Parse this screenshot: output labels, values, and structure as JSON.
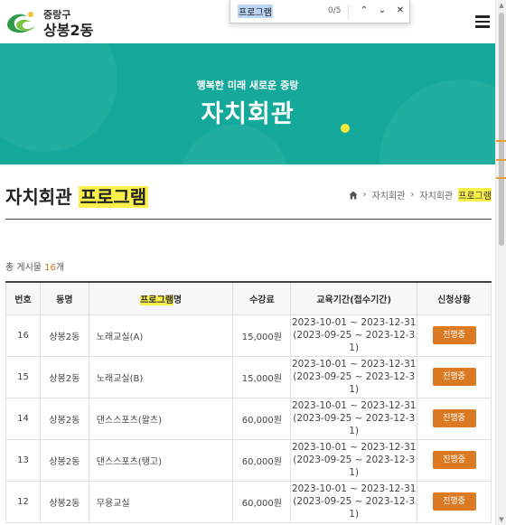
{
  "header": {
    "district": "중랑구",
    "dong": "상봉2동",
    "logo_icon": "jungnang-logo"
  },
  "findbar": {
    "query": "프로그램",
    "count": "0/5"
  },
  "hero": {
    "subtitle": "행복한 미래 새로운 중랑",
    "title": "자치회관"
  },
  "page": {
    "title_main": "자치회관",
    "title_highlight": "프로그램",
    "breadcrumb": [
      "자치회관",
      "자치회관",
      "프로그램"
    ]
  },
  "listing": {
    "total_prefix": "총 게시물",
    "total_count": "16",
    "total_suffix": "개"
  },
  "table": {
    "headers": {
      "no": "번호",
      "dong": "동명",
      "program_highlight": "프로그램",
      "program_suffix": "명",
      "fee": "수강료",
      "period": "교육기간(접수기간)",
      "status": "신청상황"
    },
    "rows": [
      {
        "no": "16",
        "dong": "상봉2동",
        "name": "노래교실(A)",
        "fee": "15,000원",
        "period1": "2023-10-01 ~ 2023-12-31",
        "period2": "(2023-09-25 ~ 2023-12-3",
        "period3": "1)",
        "status": "진행중"
      },
      {
        "no": "15",
        "dong": "상봉2동",
        "name": "노래교실(B)",
        "fee": "15,000원",
        "period1": "2023-10-01 ~ 2023-12-31",
        "period2": "(2023-09-25 ~ 2023-12-3",
        "period3": "1)",
        "status": "진행중"
      },
      {
        "no": "14",
        "dong": "상봉2동",
        "name": "댄스스포츠(왈츠)",
        "fee": "60,000원",
        "period1": "2023-10-01 ~ 2023-12-31",
        "period2": "(2023-09-25 ~ 2023-12-3",
        "period3": "1)",
        "status": "진행중"
      },
      {
        "no": "13",
        "dong": "상봉2동",
        "name": "댄스스포츠(탱고)",
        "fee": "60,000원",
        "period1": "2023-10-01 ~ 2023-12-31",
        "period2": "(2023-09-25 ~ 2023-12-3",
        "period3": "1)",
        "status": "진행중"
      },
      {
        "no": "12",
        "dong": "상봉2동",
        "name": "무용교실",
        "fee": "60,000원",
        "period1": "2023-10-01 ~ 2023-12-31",
        "period2": "(2023-09-25 ~ 2023-12-3",
        "period3": "1)",
        "status": "진행중"
      }
    ]
  },
  "colors": {
    "hero_bg": "#14a99a",
    "highlight": "#f9f04a",
    "status_btn": "#dc7a23",
    "count_accent": "#d4731d"
  }
}
